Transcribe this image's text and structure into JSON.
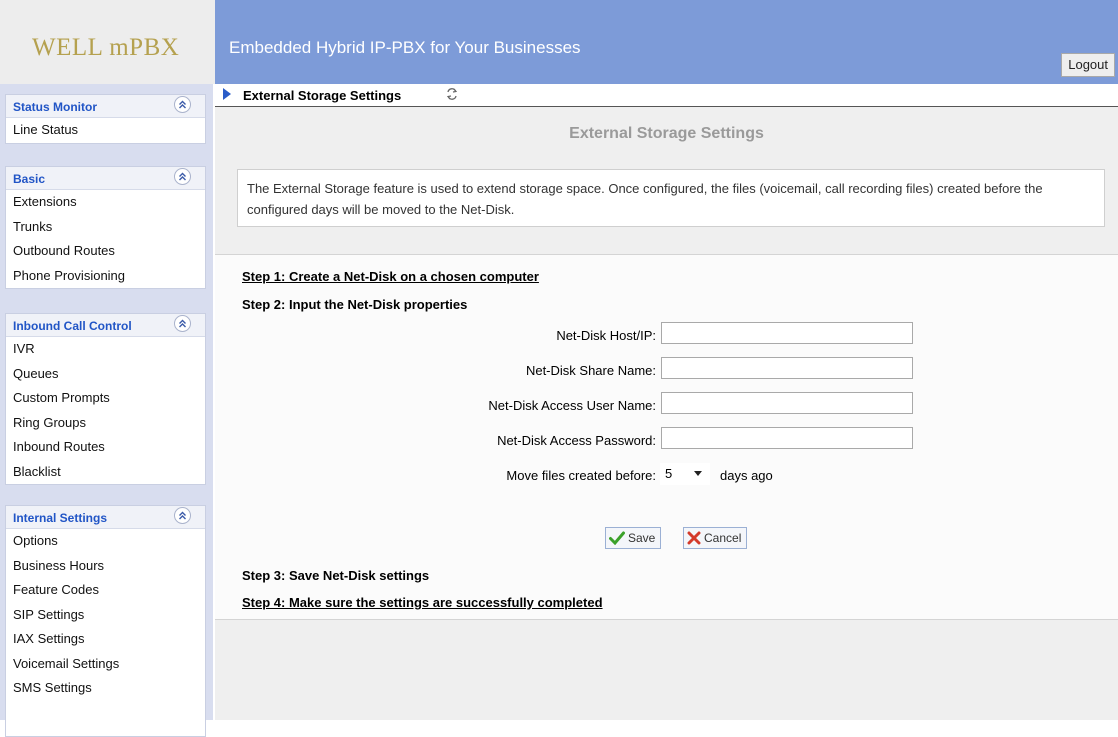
{
  "header": {
    "logo": "WELL mPBX",
    "title": "Embedded Hybrid IP-PBX for Your Businesses",
    "logout_label": "Logout",
    "brand_color": "#7d9bd8"
  },
  "sidebar": {
    "groups": [
      {
        "title": "Status Monitor",
        "items": [
          "Line Status"
        ]
      },
      {
        "title": "Basic",
        "items": [
          "Extensions",
          "Trunks",
          "Outbound Routes",
          "Phone Provisioning"
        ]
      },
      {
        "title": "Inbound Call Control",
        "items": [
          "IVR",
          "Queues",
          "Custom Prompts",
          "Ring Groups",
          "Inbound Routes",
          "Blacklist"
        ]
      },
      {
        "title": "Internal Settings",
        "items": [
          "Options",
          "Business Hours",
          "Feature Codes",
          "SIP Settings",
          "IAX Settings",
          "Voicemail Settings",
          "SMS Settings"
        ]
      }
    ],
    "collapse_icon": "double-chevron-up-icon"
  },
  "breadcrumb": {
    "text": "External Storage Settings",
    "icon": "refresh-icon"
  },
  "page": {
    "title": "External Storage Settings",
    "info": "The External Storage feature is used to extend storage space. Once configured, the files (voicemail, call recording files) created before the configured days will be moved to the Net-Disk.",
    "steps": [
      "Step 1: Create a Net-Disk on a chosen computer",
      "Step 2: Input the Net-Disk properties",
      "Step 3: Save Net-Disk settings",
      "Step 4: Make sure the settings are successfully completed"
    ],
    "fields": [
      {
        "label": "Net-Disk Host/IP:",
        "value": ""
      },
      {
        "label": "Net-Disk Share Name:",
        "value": ""
      },
      {
        "label": "Net-Disk Access User Name:",
        "value": ""
      },
      {
        "label": "Net-Disk Access Password:",
        "value": ""
      }
    ],
    "move_label": "Move files created before:",
    "days_value": "5",
    "days_suffix": "days ago",
    "save_label": "Save",
    "cancel_label": "Cancel"
  }
}
